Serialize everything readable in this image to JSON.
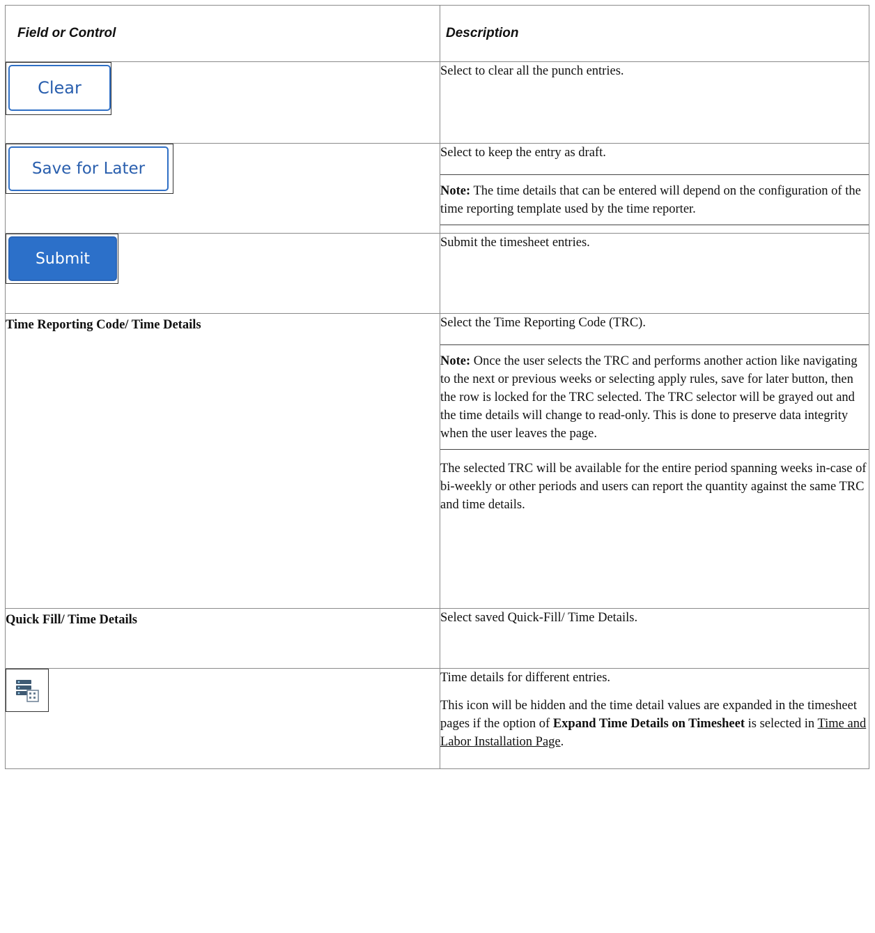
{
  "header": {
    "col1": "Field or Control",
    "col2": "Description"
  },
  "rows": {
    "clear": {
      "button_label": "Clear",
      "desc": "Select to clear all the punch entries."
    },
    "save": {
      "button_label": "Save for Later",
      "desc": "Select to keep the entry as draft.",
      "note_label": "Note:",
      "note_text": " The time details that can be entered will depend on the configuration of the time reporting template used by the time reporter."
    },
    "submit": {
      "button_label": "Submit",
      "desc": "Submit the timesheet entries."
    },
    "trc": {
      "field": "Time Reporting Code/ Time Details",
      "desc": "Select the Time Reporting Code (TRC).",
      "note_label": "Note:",
      "note_text": " Once the user selects the TRC and performs another action like navigating to the next or previous weeks or selecting apply rules, save for later button, then the row is locked for the TRC selected. The TRC selector will be grayed out and the time details will change to read-only. This is done to preserve data integrity when the user leaves the page.",
      "after": "The selected TRC will be available for the entire period spanning weeks in-case of bi-weekly or other periods and users can report the quantity against the same TRC and time details."
    },
    "quickfill": {
      "field": "Quick Fill/ Time Details",
      "desc": "Select saved Quick-Fill/ Time Details."
    },
    "timedetails": {
      "icon": "time-details-icon",
      "desc": "Time details for different entries.",
      "para_part1": "This icon will be hidden and the time detail values are expanded in the timesheet pages if the option of ",
      "para_bold": " Expand Time Details on Timesheet",
      "para_part2": " is selected in ",
      "para_link": "Time and Labor Installation Page",
      "para_end": "."
    }
  },
  "colors": {
    "button_blue": "#2c70c9",
    "border": "#8a8a8a"
  }
}
